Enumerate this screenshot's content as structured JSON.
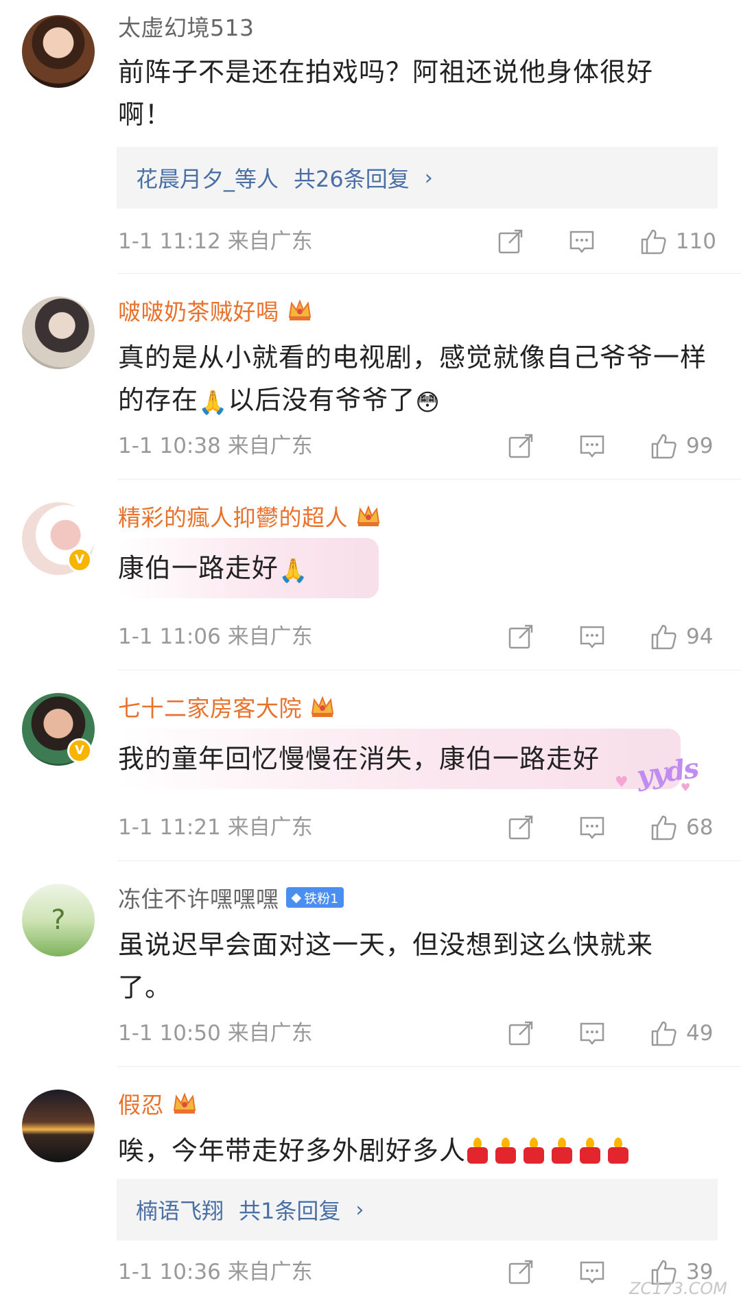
{
  "comments": [
    {
      "name": "太虚幻境513",
      "text": "前阵子不是还在拍戏吗？阿祖还说他身体很好啊！",
      "replies": {
        "names": "花晨月夕_等人",
        "count_label": "共26条回复"
      },
      "time": "1-1 11:12",
      "location": "来自广东",
      "likes": "110"
    },
    {
      "name": "啵啵奶茶贼好喝",
      "text": "真的是从小就看的电视剧，感觉就像自己爷爷一样的存在",
      "text_after": "以后没有爷爷了",
      "time": "1-1 10:38",
      "location": "来自广东",
      "likes": "99"
    },
    {
      "name": "精彩的瘋人抑鬱的超人",
      "text": "康伯一路走好",
      "time": "1-1 11:06",
      "location": "来自广东",
      "likes": "94"
    },
    {
      "name": "七十二家房客大院",
      "text": "我的童年回忆慢慢在消失，康伯一路走好",
      "sticker": "yyds",
      "time": "1-1 11:21",
      "location": "来自广东",
      "likes": "68"
    },
    {
      "name": "冻住不许嘿嘿嘿",
      "fan_badge": "铁粉1",
      "text": "虽说迟早会面对这一天，但没想到这么快就来了。",
      "time": "1-1 10:50",
      "location": "来自广东",
      "likes": "49"
    },
    {
      "name": "假忍",
      "text": "唉，今年带走好多外剧好多人",
      "replies": {
        "names": "楠语飞翔",
        "count_label": "共1条回复"
      },
      "time": "1-1 10:36",
      "location": "来自广东",
      "likes": "39"
    }
  ],
  "icons": {
    "share": "share-icon",
    "comment": "comment-icon",
    "like": "thumbs-up-icon",
    "crown": "crown-icon",
    "verified": "verified-badge-icon"
  },
  "watermark": "ZC173.COM",
  "colors": {
    "vip_name": "#e8722c",
    "plain_name": "#666666",
    "reply_link": "#4a6fa5",
    "meta": "#999999",
    "verified": "#f7b500",
    "fan_badge": "#4a8ff0"
  }
}
